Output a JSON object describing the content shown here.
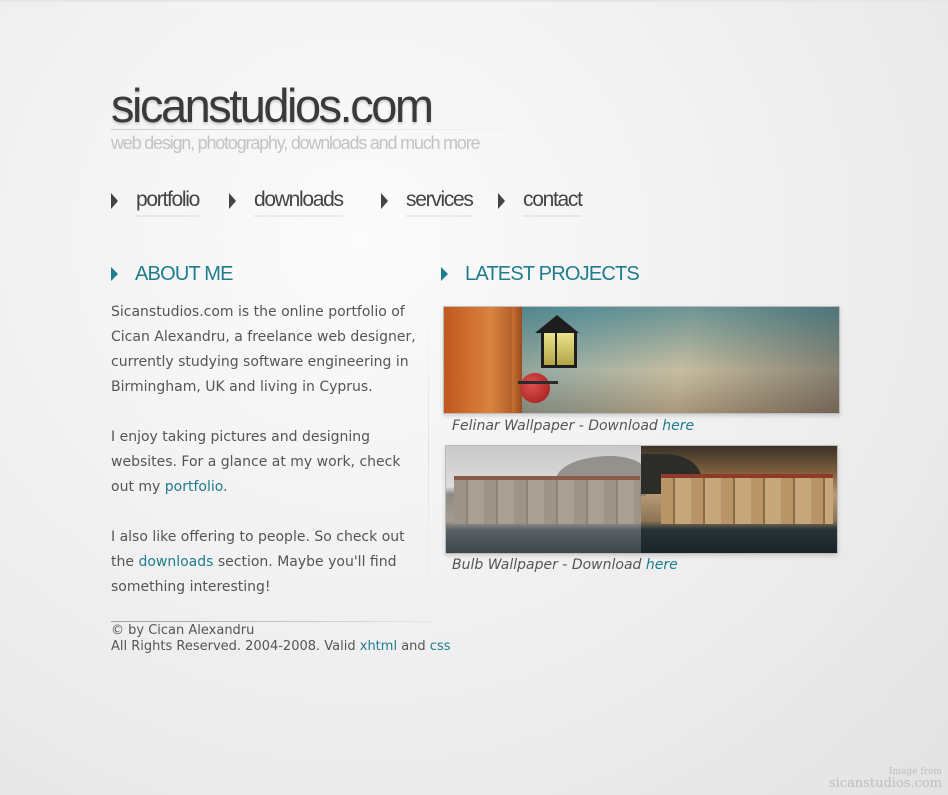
{
  "site": {
    "logo": "sicanstudios.com",
    "tagline": "web design, photography, downloads and much more"
  },
  "nav": {
    "items": [
      {
        "label": "portfolio"
      },
      {
        "label": "downloads"
      },
      {
        "label": "services"
      },
      {
        "label": "contact"
      }
    ]
  },
  "about": {
    "title": "ABOUT ME",
    "p1": "Sicanstudios.com is the online portfolio of Cican Alexandru, a freelance web designer, currently studying software engineering in Birmingham, UK and living in Cyprus.",
    "p2_before": "I enjoy taking pictures and designing websites. For a glance at my work, check out my ",
    "p2_link": "portfolio",
    "p2_after": ".",
    "p3_before": "I also like offering to people. So check out the ",
    "p3_link": "downloads",
    "p3_after": " section. Maybe you'll find something interesting!"
  },
  "footer": {
    "line1": "© by Cican Alexandru",
    "line2_before": "All Rights Reserved. 2004-2008. Valid ",
    "xhtml_link": "xhtml",
    "and_text": " and ",
    "css_link": "css"
  },
  "projects": {
    "title": "LATEST PROJECTS",
    "items": [
      {
        "caption": "Felinar Wallpaper - Download ",
        "link": "here"
      },
      {
        "caption": "Bulb Wallpaper - Download ",
        "link": "here"
      }
    ]
  },
  "watermark": {
    "line1": "Image from",
    "line2": "sicanstudios.com"
  },
  "colors": {
    "accent": "#1f7c8d",
    "text": "#555555",
    "nav": "#444444"
  }
}
